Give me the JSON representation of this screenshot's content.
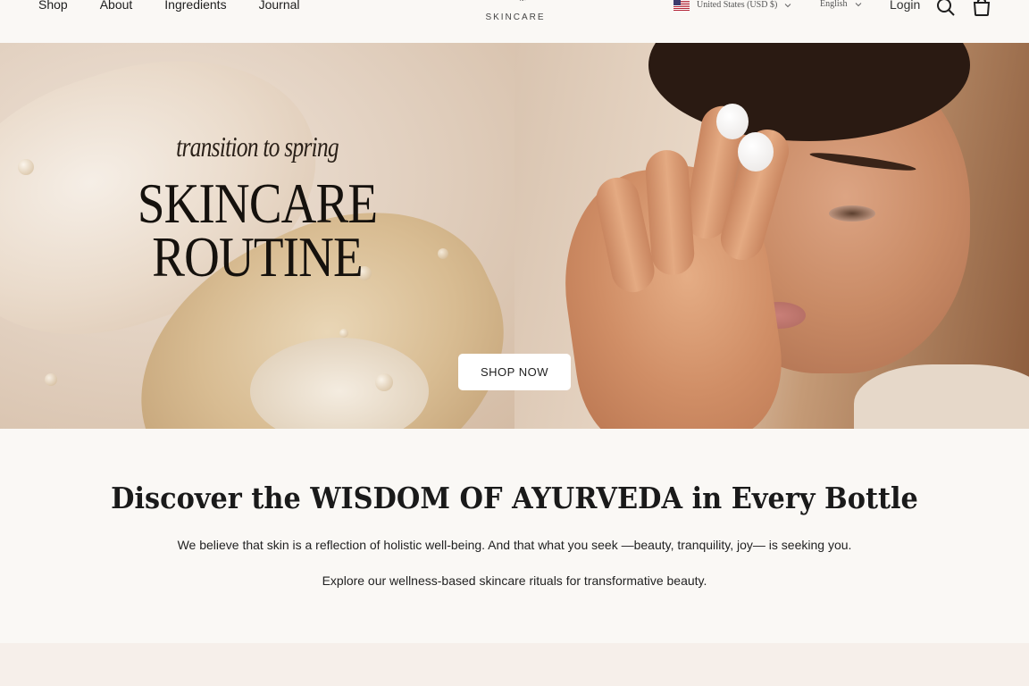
{
  "header": {
    "nav": [
      "Shop",
      "About",
      "Ingredients",
      "Journal"
    ],
    "logo_text": "SKINCARE",
    "country": "United States (USD $)",
    "language": "English",
    "login": "Login",
    "icons": {
      "flag": "us-flag-icon",
      "search": "search-icon",
      "cart": "bag-icon",
      "chevron": "chevron-down-icon"
    }
  },
  "hero": {
    "subtitle": "transition to spring",
    "title_line1": "SKINCARE",
    "title_line2": "ROUTINE",
    "button": "SHOP NOW"
  },
  "intro": {
    "heading": "Discover the WISDOM OF AYURVEDA in Every Bottle",
    "paragraph1": "We believe that skin is a reflection of holistic well-being. And that what you seek —beauty, tranquility, joy— is seeking you.",
    "paragraph2": "Explore our wellness-based skincare rituals for transformative beauty."
  },
  "colors": {
    "background": "#faf8f5",
    "text": "#1e1e1e",
    "button": "#ffffff"
  }
}
